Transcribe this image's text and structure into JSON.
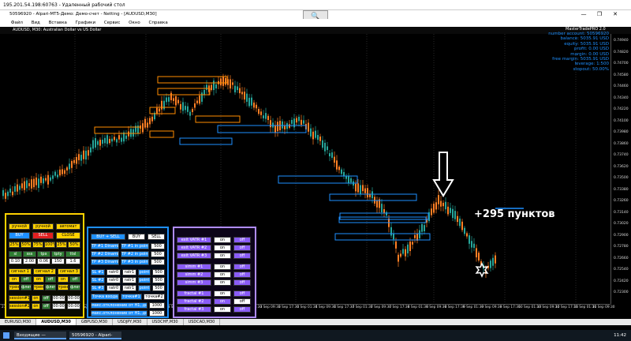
{
  "rdp": {
    "title": "195.201.54.198:60763 - Удаленный рабочий стол",
    "zoom_icon": "🔍"
  },
  "window": {
    "title": "50596920 - Alpari-MT5-Демо: Демо-счет - Netting - [AUDUSD,M30]",
    "controls": [
      "—",
      "❐",
      "✕"
    ]
  },
  "menu": [
    "Файл",
    "Вид",
    "Вставка",
    "Графики",
    "Сервис",
    "Окно",
    "Справка"
  ],
  "chart": {
    "name": "AUDUSD, M30:  Australian Dollar vs US Dollar",
    "indicator": "MasterTradePRO 2.0",
    "account": [
      "number account: 50596920",
      "balance: 5035.91 USD",
      "equity: 5035.91 USD",
      "profit: 0.00 USD",
      "margin: 0.00 USD",
      "free margin: 5035.91 USD",
      "leverage: 1:500",
      "stopout: 50.00%"
    ],
    "annotation": "+295 пунктов",
    "price_ticks": [
      "0.74940",
      "0.74820",
      "0.74700",
      "0.74580",
      "0.74460",
      "0.74340",
      "0.74220",
      "0.74100",
      "0.73980",
      "0.73860",
      "0.73740",
      "0.73620",
      "0.73500",
      "0.73380",
      "0.73260",
      "0.73140",
      "0.73020",
      "0.72900",
      "0.72780",
      "0.72660",
      "0.72540",
      "0.72420",
      "0.72300"
    ],
    "time_ticks": [
      "27 Aug 2020",
      "28 Aug 02:30",
      "28 Aug 09:30",
      "28 Aug 17:30",
      "31 Aug 01:30",
      "31 Aug 09:30",
      "31 Aug 17:30",
      "1 Sep 01:30",
      "1 Sep 09:30",
      "1 Sep 17:30",
      "2 Sep 01:30",
      "2 Sep 09:30",
      "2 Sep 17:30",
      "3 Sep 01:30",
      "3 Sep 09:30",
      "3 Sep 17:30",
      "4 Sep 01:30",
      "4 Sep 09:30",
      "4 Sep 17:30",
      "7 Sep 01:30",
      "7 Sep 09:30",
      "7 Sep 17:30",
      "8 Sep 01:30",
      "8 Sep 09:30",
      "8 Sep 17:30",
      "9 Sep 01:30",
      "9 Sep 09:30",
      "9 Sep 17:30",
      "10 Sep 01:30",
      "10 Sep 09:30",
      "10 Sep 17:30",
      "11 Sep 01:30",
      "11 Sep 09:30"
    ],
    "colors": {
      "up": "#26a69a",
      "down": "#ff7f24",
      "ob_orange": "#ff8c00",
      "ob_blue": "#1e90ff",
      "arrow": "#ffffff"
    }
  },
  "yellow_panel": {
    "mode_row": [
      "ручной",
      "ручной",
      "автомат"
    ],
    "buy": "BUY",
    "sell": "SELL",
    "close": "CLOSE",
    "pct_row": [
      "25%",
      "50%",
      "75%",
      "100%",
      "25%",
      "50%"
    ],
    "header_row": [
      "sl",
      "sss",
      "tpx",
      "tpty",
      "ttsl"
    ],
    "values_row": [
      "0.10",
      "2.00",
      "0.06",
      "150",
      "1.6"
    ],
    "signals": [
      "сигнал 1",
      "сигнал 2",
      "сигнал 3"
    ],
    "onoff": [
      "on",
      "off",
      "on",
      "off",
      "on",
      "off"
    ],
    "trend_flat": [
      "тренд",
      "флет",
      "тренд",
      "флет",
      "тренд",
      "флет"
    ],
    "session1": "session#1",
    "session2": "session#2",
    "times": [
      "00:00",
      "00:00",
      "00:00",
      "00:00"
    ]
  },
  "blue_panel": {
    "top": [
      "BUY + SELL",
      "BUY",
      "SELL"
    ],
    "tp_rows": [
      {
        "label": "TP #1 Dinamic",
        "mode": "TP #1 in point",
        "val": "500"
      },
      {
        "label": "TP #2 Dinamic",
        "mode": "TP #2 in point",
        "val": "500"
      },
      {
        "label": "TP #3 Dinamic",
        "mode": "TP #3 in point",
        "val": "500"
      }
    ],
    "sl_rows": [
      {
        "label": "SL #1",
        "a": "ratr0",
        "b": "ratr1",
        "c": "point",
        "val": "500"
      },
      {
        "label": "SL #2",
        "a": "ratr0",
        "b": "ratr1",
        "c": "point",
        "val": "500"
      },
      {
        "label": "SL #3",
        "a": "ratr0",
        "b": "ratr1",
        "c": "point",
        "val": "500"
      }
    ],
    "entry_row": [
      "Точка входа",
      "точка#1",
      "точка#2"
    ],
    "offsets": [
      {
        "label": "макс.отклонение от Н1, дни",
        "val": "1000"
      },
      {
        "label": "макс.отклонение от Н1, дни",
        "val": "1000"
      }
    ]
  },
  "purple_panel": {
    "rows": [
      {
        "label": "exit VATR #1",
        "on": "on",
        "off": "off"
      },
      {
        "label": "exit VATR #2",
        "on": "on",
        "off": "off"
      },
      {
        "label": "exit VATR #3",
        "on": "on",
        "off": "off"
      },
      {
        "label": "simm #1",
        "on": "on",
        "off": "off"
      },
      {
        "label": "simm #2",
        "on": "on",
        "off": "off"
      },
      {
        "label": "simm #3",
        "on": "on",
        "off": "off"
      },
      {
        "label": "fractal #1",
        "on": "on",
        "off": "off"
      },
      {
        "label": "fractal #2",
        "on": "on",
        "off": "off"
      },
      {
        "label": "fractal #3",
        "on": "on",
        "off": "off"
      }
    ]
  },
  "symbol_tabs": [
    "EURUSD,M30",
    "AUDUSD,M30",
    "GBPUSD,M30",
    "USDJPY,M30",
    "USDCHF,M30",
    "USDCAD,M30"
  ],
  "taskbar": {
    "items": [
      "Входящие — Яндекс...",
      "50596920 - Alpari-MT5..."
    ],
    "clock": "11:42"
  }
}
